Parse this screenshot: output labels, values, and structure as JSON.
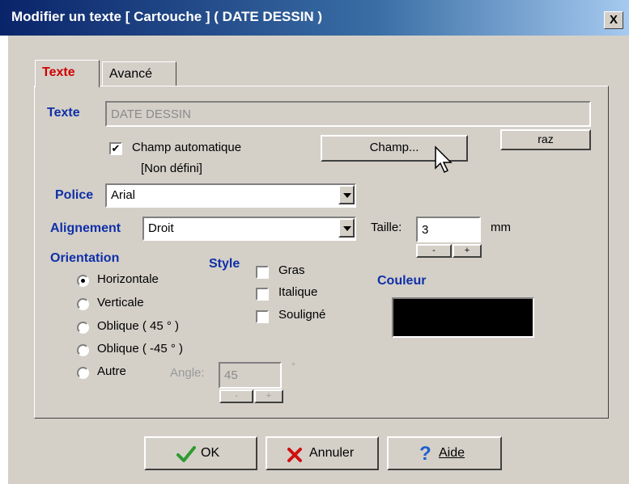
{
  "window": {
    "title": "Modifier un texte [ Cartouche ] ( DATE DESSIN )",
    "close_label": "X"
  },
  "tabs": [
    {
      "label": "Texte",
      "active": true
    },
    {
      "label": "Avancé",
      "active": false
    }
  ],
  "texte": {
    "label": "Texte",
    "value": "DATE DESSIN",
    "raz_label": "raz",
    "auto_field_label": "Champ automatique",
    "auto_field_checked": true,
    "auto_field_status": "[Non défini]",
    "champ_button_label": "Champ..."
  },
  "police": {
    "label": "Police",
    "value": "Arial"
  },
  "alignement": {
    "label": "Alignement",
    "value": "Droit"
  },
  "taille": {
    "label": "Taille:",
    "value": "3",
    "unit": "mm",
    "minus": "-",
    "plus": "+"
  },
  "orientation": {
    "label": "Orientation",
    "options": [
      {
        "label": "Horizontale",
        "checked": true
      },
      {
        "label": "Verticale",
        "checked": false
      },
      {
        "label": "Oblique ( 45 ° )",
        "checked": false
      },
      {
        "label": "Oblique ( -45 ° )",
        "checked": false
      },
      {
        "label": "Autre",
        "checked": false
      }
    ],
    "angle_label": "Angle:",
    "angle_value": "45",
    "angle_unit": "°",
    "minus": "-",
    "plus": "+"
  },
  "style": {
    "label": "Style",
    "options": [
      {
        "label": "Gras",
        "checked": false
      },
      {
        "label": "Italique",
        "checked": false
      },
      {
        "label": "Souligné",
        "checked": false
      }
    ]
  },
  "couleur": {
    "label": "Couleur",
    "color": "#000000"
  },
  "footer": {
    "ok_label": "OK",
    "annuler_label": "Annuler",
    "aide_label": "Aide",
    "ok_icon": "checkmark-icon",
    "annuler_icon": "x-icon",
    "aide_icon": "question-icon"
  },
  "colors": {
    "title_bar": "#0a246a",
    "dialog_bg": "#d4d0c8",
    "label_blue": "#0f2fa8",
    "active_tab_red": "#d00000"
  }
}
